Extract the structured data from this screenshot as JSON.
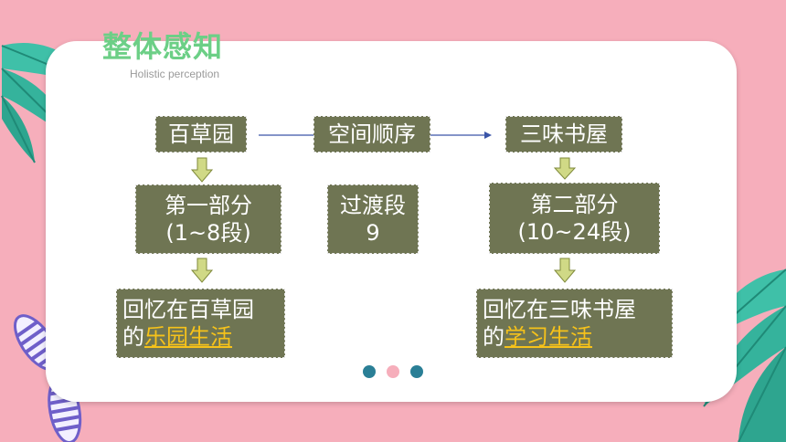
{
  "header": {
    "title": "整体感知",
    "subtitle": "Holistic perception"
  },
  "diagram": {
    "left_top": "百草园",
    "middle_top": "空间顺序",
    "right_top": "三味书屋",
    "left_mid_line1": "第一部分",
    "left_mid_line2": "(1~8段)",
    "middle_mid_line1": "过渡段",
    "middle_mid_line2": "9",
    "right_mid_line1": "第二部分",
    "right_mid_line2": "(10~24段)",
    "left_bottom_line1": "回忆在百草园",
    "left_bottom_prefix": "的",
    "left_bottom_highlight": "乐园生活",
    "right_bottom_line1": "回忆在三味书屋",
    "right_bottom_prefix": "的",
    "right_bottom_highlight": "学习生活"
  },
  "colors": {
    "background": "#f6aebb",
    "title": "#6ccf86",
    "box": "#6f7553",
    "highlight": "#f6c21a",
    "dot_teal": "#2a7f96",
    "dot_pink": "#f6aebb"
  },
  "pagination": {
    "dot_count": 3,
    "active_index": 1
  }
}
